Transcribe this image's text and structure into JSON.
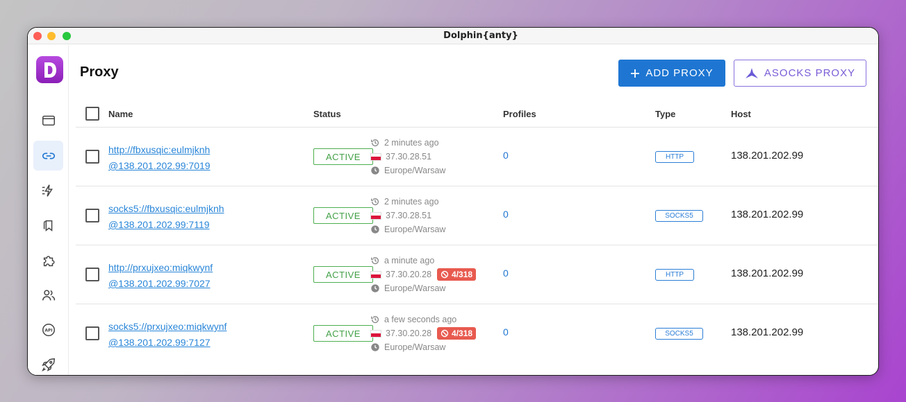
{
  "window": {
    "title": "Dolphin{anty}"
  },
  "sidebar": {
    "items": [
      {
        "icon": "browser-window-icon"
      },
      {
        "icon": "link-icon",
        "active": true
      },
      {
        "icon": "automation-icon"
      },
      {
        "icon": "bookmarks-icon"
      },
      {
        "icon": "extension-icon"
      },
      {
        "icon": "users-icon"
      },
      {
        "icon": "api-icon"
      },
      {
        "icon": "rocket-icon"
      }
    ]
  },
  "page": {
    "title": "Proxy"
  },
  "toolbar": {
    "add_label": "ADD PROXY",
    "asocks_label": "ASOCKS PROXY"
  },
  "table": {
    "columns": {
      "name": "Name",
      "status": "Status",
      "profiles": "Profiles",
      "type": "Type",
      "host": "Host"
    },
    "rows": [
      {
        "name_line1": "http://fbxusqic:eulmjknh",
        "name_line2": "@138.201.202.99:7019",
        "status": "ACTIVE",
        "checked": "2 minutes ago",
        "ip": "37.30.28.51",
        "ban": "",
        "timezone": "Europe/Warsaw",
        "profiles": "0",
        "type": "HTTP",
        "host": "138.201.202.99"
      },
      {
        "name_line1": "socks5://fbxusqic:eulmjknh",
        "name_line2": "@138.201.202.99:7119",
        "status": "ACTIVE",
        "checked": "2 minutes ago",
        "ip": "37.30.28.51",
        "ban": "",
        "timezone": "Europe/Warsaw",
        "profiles": "0",
        "type": "SOCKS5",
        "host": "138.201.202.99"
      },
      {
        "name_line1": "http://prxujxeo:miqkwynf",
        "name_line2": "@138.201.202.99:7027",
        "status": "ACTIVE",
        "checked": "a minute ago",
        "ip": "37.30.20.28",
        "ban": "4/318",
        "timezone": "Europe/Warsaw",
        "profiles": "0",
        "type": "HTTP",
        "host": "138.201.202.99"
      },
      {
        "name_line1": "socks5://prxujxeo:miqkwynf",
        "name_line2": "@138.201.202.99:7127",
        "status": "ACTIVE",
        "checked": "a few seconds ago",
        "ip": "37.30.20.28",
        "ban": "4/318",
        "timezone": "Europe/Warsaw",
        "profiles": "0",
        "type": "SOCKS5",
        "host": "138.201.202.99"
      }
    ]
  },
  "colors": {
    "accent": "#1e76d2",
    "active": "#43a047",
    "ban": "#e85a4f",
    "asocks": "#7a5cd6"
  }
}
